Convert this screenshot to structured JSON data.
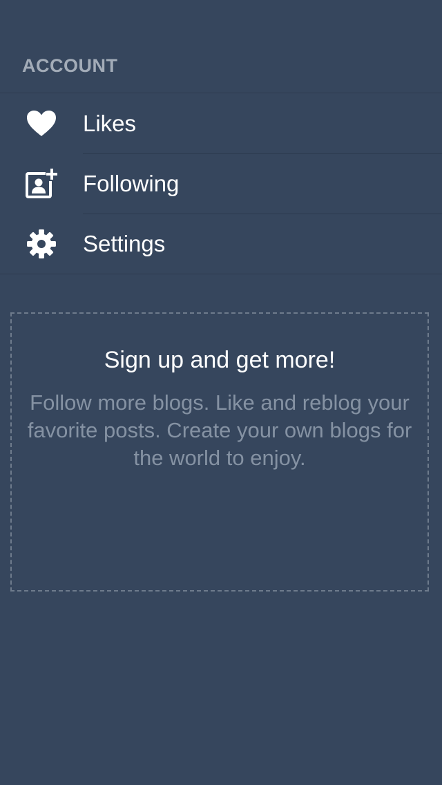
{
  "account": {
    "header": "ACCOUNT",
    "items": [
      {
        "label": "Likes",
        "icon": "heart-icon"
      },
      {
        "label": "Following",
        "icon": "add-person-icon"
      },
      {
        "label": "Settings",
        "icon": "gear-icon"
      }
    ]
  },
  "signup": {
    "title": "Sign up and get more!",
    "body": "Follow more blogs. Like and reblog your favorite posts. Create your own blogs for the world to enjoy."
  },
  "colors": {
    "background": "#36465d",
    "divider": "#2d3b4f",
    "header_text": "#a3acb8",
    "muted_text": "#8592a3",
    "dashed_border": "#6e7b8c"
  }
}
